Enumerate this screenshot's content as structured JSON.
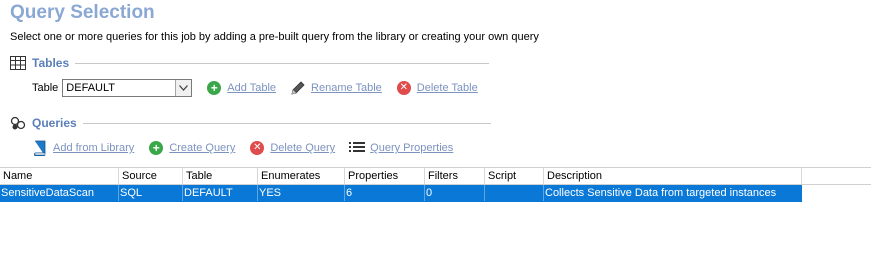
{
  "page": {
    "title": "Query Selection",
    "subtitle": "Select one or more queries for this job by adding a pre-built query from the library or creating your own query"
  },
  "tables_section": {
    "heading": "Tables",
    "table_label": "Table",
    "selected_table": "DEFAULT",
    "add_label": "Add Table",
    "rename_label": "Rename Table",
    "delete_label": "Delete Table"
  },
  "queries_section": {
    "heading": "Queries",
    "add_library_label": "Add from Library",
    "create_label": "Create Query",
    "delete_label": "Delete Query",
    "properties_label": "Query Properties"
  },
  "grid": {
    "columns": [
      "Name",
      "Source",
      "Table",
      "Enumerates",
      "Properties",
      "Filters",
      "Script",
      "Description"
    ],
    "rows": [
      {
        "name": "SensitiveDataScan",
        "source": "SQL",
        "table": "DEFAULT",
        "enumerates": "YES",
        "properties": "6",
        "filters": "0",
        "script": "",
        "description": "Collects Sensitive Data from targeted instances"
      }
    ]
  },
  "colors": {
    "title": "#8aa8d4",
    "section_heading": "#5b7fb8",
    "link": "#7c93c0",
    "selected_row": "#0a78d7",
    "add_icon": "#3aa84a",
    "delete_icon": "#e04c4c"
  }
}
